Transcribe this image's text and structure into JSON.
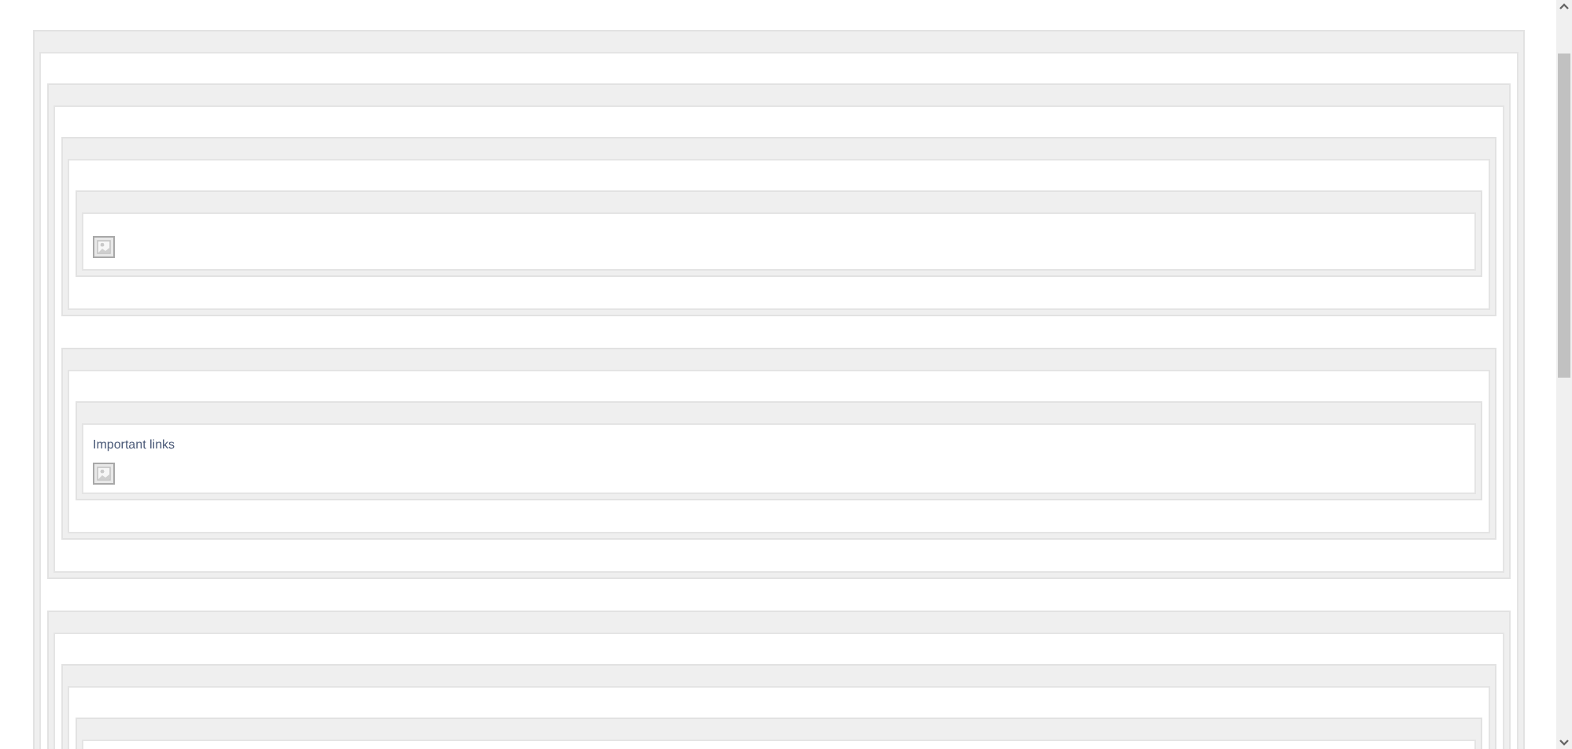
{
  "panels": [
    {
      "kind": "panel",
      "children": [
        {
          "kind": "panel",
          "children": [
            {
              "kind": "panel",
              "children": [
                {
                  "kind": "panel",
                  "content": [
                    {
                      "kind": "image"
                    }
                  ]
                }
              ]
            },
            {
              "kind": "panel",
              "children": [
                {
                  "kind": "panel",
                  "content": [
                    {
                      "kind": "text",
                      "text": "Important links"
                    },
                    {
                      "kind": "image"
                    }
                  ]
                }
              ]
            }
          ]
        },
        {
          "kind": "panel",
          "children": [
            {
              "kind": "panel",
              "children": [
                {
                  "kind": "panel"
                }
              ]
            }
          ]
        }
      ]
    }
  ]
}
